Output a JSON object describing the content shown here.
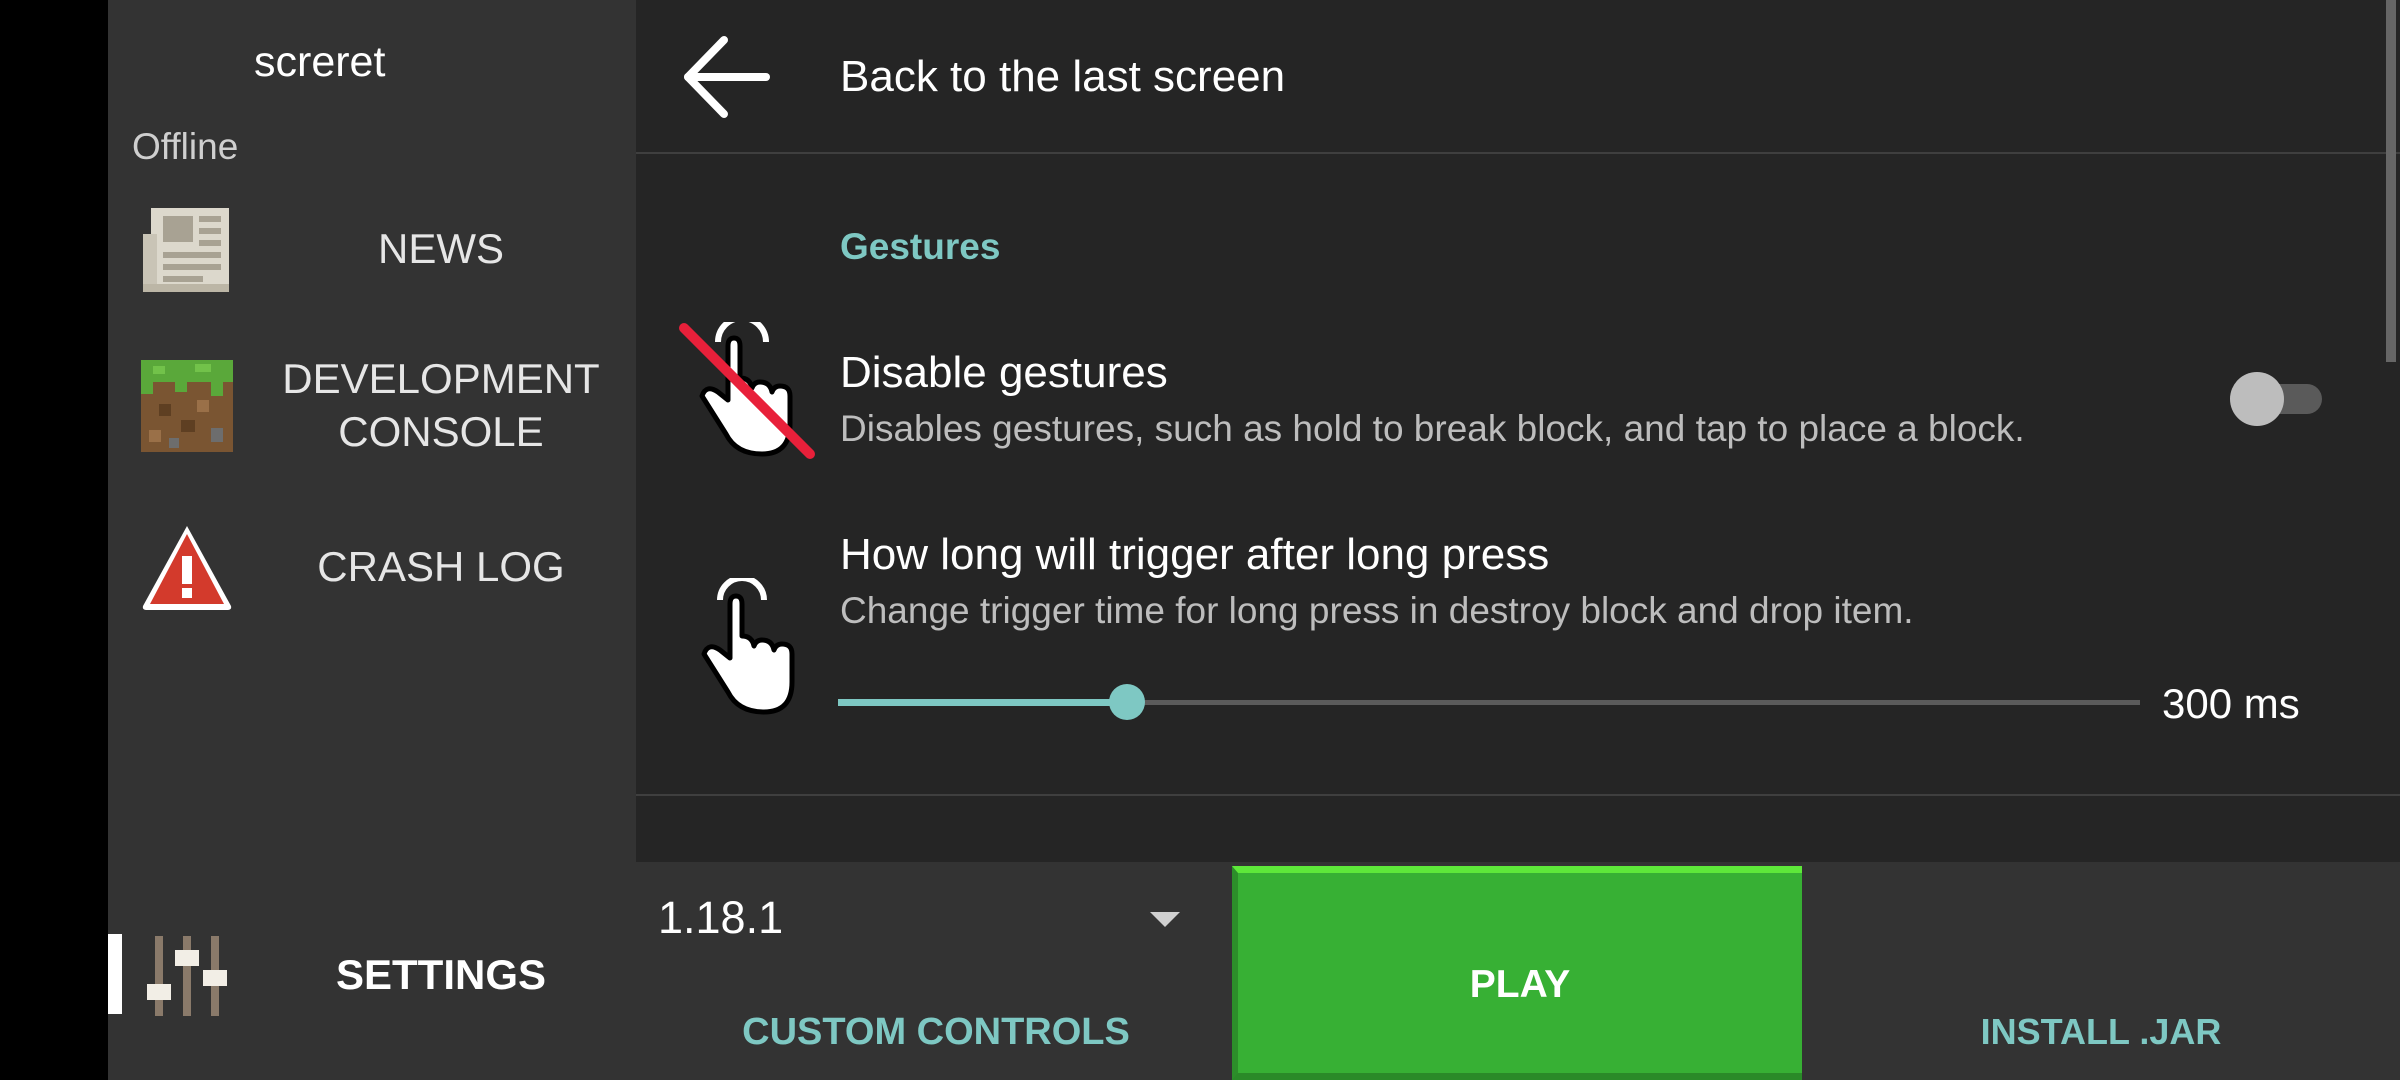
{
  "account": {
    "name": "screret",
    "status": "Offline"
  },
  "sidebar": {
    "items": [
      {
        "label": "NEWS",
        "icon": "newspaper-icon"
      },
      {
        "label": "DEVELOPMENT\nCONSOLE",
        "icon": "grass-block-icon"
      },
      {
        "label": "CRASH LOG",
        "icon": "warning-icon"
      }
    ],
    "settings": {
      "label": "SETTINGS",
      "icon": "sliders-icon",
      "active": true
    }
  },
  "header": {
    "back_label": "Back to the last screen",
    "icon": "back-arrow-icon"
  },
  "section": {
    "title": "Gestures"
  },
  "preferences": [
    {
      "title": "Disable gestures",
      "summary": "Disables gestures, such as hold to break block, and tap to place a block.",
      "icon": "gesture-disabled-icon",
      "control": "toggle",
      "enabled": false
    },
    {
      "title": "How long will trigger after long press",
      "summary": "Change trigger time for long press in destroy block and drop item.",
      "icon": "tap-hand-icon",
      "control": "slider",
      "slider_fraction": 0.222,
      "value_text": "300 ms"
    }
  ],
  "bottom": {
    "version": "1.18.1",
    "custom_controls": "CUSTOM CONTROLS",
    "play": "PLAY",
    "install_jar": "INSTALL .JAR"
  },
  "colors": {
    "accent": "#7ec8c3",
    "play_green": "#37b034",
    "sidebar_bg": "#333333",
    "main_bg": "#252525"
  }
}
